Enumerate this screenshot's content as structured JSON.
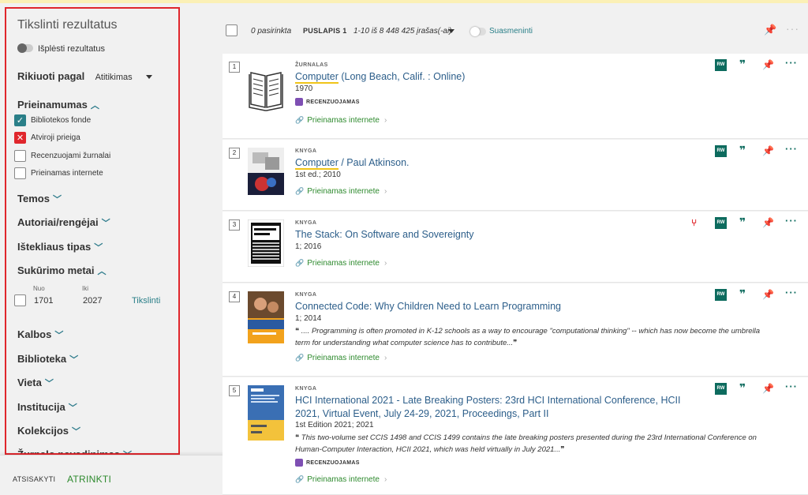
{
  "sidebar": {
    "title": "Tikslinti rezultatus",
    "expand_label": "Išplėsti rezultatus",
    "sort_label": "Rikiuoti pagal",
    "sort_value": "Atitikimas",
    "availability": {
      "title": "Prieinamumas",
      "options": [
        {
          "label": "Bibliotekos fonde",
          "state": "checked"
        },
        {
          "label": "Atviroji prieiga",
          "state": "excluded"
        },
        {
          "label": "Recenzuojami žurnalai",
          "state": "unchecked"
        },
        {
          "label": "Prieinamas internete",
          "state": "unchecked"
        }
      ]
    },
    "facets_a": [
      "Temos",
      "Autoriai/rengėjai",
      "Ištekliaus tipas"
    ],
    "creation_years": {
      "title": "Sukūrimo metai",
      "from_label": "Nuo",
      "to_label": "Iki",
      "from": "1701",
      "to": "2027",
      "apply": "Tikslinti"
    },
    "facets_b": [
      "Kalbos",
      "Biblioteka",
      "Vieta",
      "Institucija",
      "Kolekcijos",
      "Žurnalo pavadinimas"
    ]
  },
  "bottom": {
    "cancel": "ATSISAKYTI",
    "apply": "ATRINKTI"
  },
  "toolbar": {
    "selected": "0 pasirinkta",
    "page": "PUSLAPIS 1",
    "range": "1-10 iš 8 448 425 įrašas(-ai)",
    "summarize": "Suasmeninti"
  },
  "results": [
    {
      "num": "1",
      "type": "ŽURNALAS",
      "title_hl": "Computer",
      "title_rest": " (Long Beach, Calif. : Online)",
      "meta": "1970",
      "badge": "RECENZUOJAMAS",
      "online": "Prieinamas internete",
      "thumb": "book-icon"
    },
    {
      "num": "2",
      "type": "KNYGA",
      "title_hl": "Computer",
      "title_rest": " / Paul Atkinson.",
      "meta": "1st ed.; 2010",
      "online": "Prieinamas internete",
      "thumb": "cover-computer"
    },
    {
      "num": "3",
      "type": "KNYGA",
      "title_hl": "",
      "title_rest": "The Stack: On Software and Sovereignty",
      "meta": "1; 2016",
      "online": "Prieinamas internete",
      "thumb": "cover-stack"
    },
    {
      "num": "4",
      "type": "KNYGA",
      "title_hl": "",
      "title_rest": "Connected Code: Why Children Need to Learn Programming",
      "meta": "1; 2014",
      "desc": " .... Programming is often promoted in K-12 schools as a way to encourage \"computational thinking\" -- which has now become the umbrella term for understanding what computer science has to contribute...",
      "online": "Prieinamas internete",
      "thumb": "cover-connected"
    },
    {
      "num": "5",
      "type": "KNYGA",
      "title_hl": "",
      "title_rest": "HCI International 2021 - Late Breaking Posters: 23rd HCI International Conference, HCII 2021, Virtual Event, July 24-29, 2021, Proceedings, Part II",
      "meta": "1st Edition 2021; 2021",
      "desc": " This two-volume set CCIS 1498 and CCIS 1499 contains the late breaking posters presented during the 23rd International Conference on Human-Computer Interaction, HCII 2021, which was held virtually in July 2021...",
      "badge": "RECENZUOJAMAS",
      "online": "Prieinamas internete",
      "thumb": "cover-hci"
    }
  ],
  "actions": {
    "rw": "RW",
    "quote": "❞",
    "pin": "📌",
    "more": "···",
    "sib": "⑂"
  },
  "colors": {
    "accent": "#2a7f88",
    "highlight_border": "#e0262c",
    "link_green": "#2e8a2e",
    "title_blue": "#2c5e8a"
  }
}
